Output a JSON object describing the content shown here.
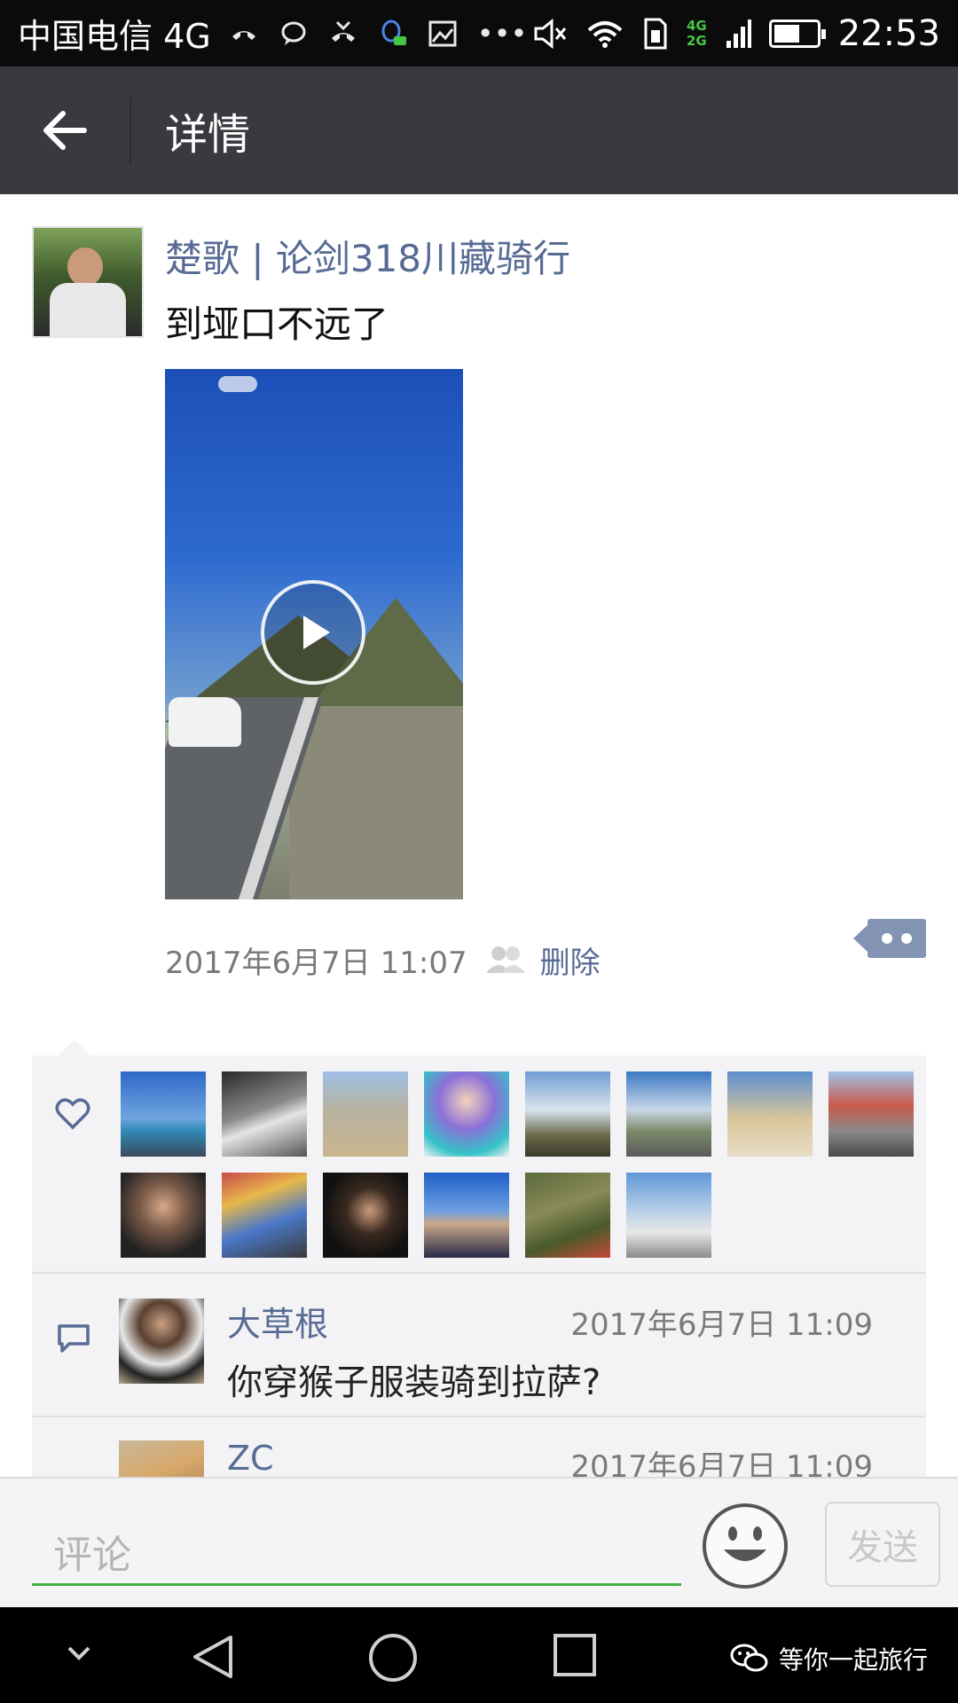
{
  "status_bar": {
    "carrier": "中国电信 4G",
    "network_top": "4G",
    "network_bottom": "2G",
    "time": "22:53"
  },
  "header": {
    "title": "详情"
  },
  "post": {
    "author": "楚歌 | 论剑318川藏骑行",
    "text": "到垭口不远了",
    "timestamp": "2017年6月7日 11:07",
    "delete_label": "删除"
  },
  "likes": {
    "count": 14
  },
  "comments": [
    {
      "name": "大草根",
      "time": "2017年6月7日 11:09",
      "text": "你穿猴子服装骑到拉萨?"
    },
    {
      "name": "ZC",
      "time": "2017年6月7日 11:09",
      "text": ""
    }
  ],
  "input": {
    "placeholder": "评论",
    "send_label": "发送"
  },
  "watermark": {
    "text": "等你一起旅行"
  },
  "colors": {
    "title_bar": "#393a3f",
    "link_blue": "#576b95",
    "input_underline": "#45b046"
  }
}
